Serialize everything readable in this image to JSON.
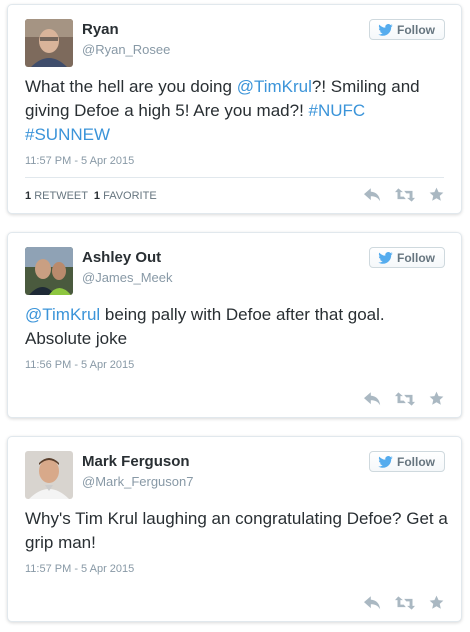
{
  "follow_label": "Follow",
  "colors": {
    "link": "#3b94d9",
    "muted": "#8899a6",
    "bird": "#55acee",
    "action_icon": "#aab8c2"
  },
  "icons": [
    "twitter-bird-icon",
    "reply-icon",
    "retweet-icon",
    "favorite-icon"
  ],
  "tweets": [
    {
      "name": "Ryan",
      "handle": "@Ryan_Rosee",
      "text_parts": [
        "What the hell are you doing ",
        "@TimKrul",
        "?! Smiling and giving Defoe a high 5! Are you mad?! ",
        "#NUFC",
        " ",
        "#SUNNEW"
      ],
      "timestamp": "11:57 PM - 5 Apr 2015",
      "retweets_count": "1",
      "retweets_label": "RETWEET",
      "favorites_count": "1",
      "favorites_label": "FAVORITE"
    },
    {
      "name": "Ashley Out",
      "handle": "@James_Meek",
      "text_parts": [
        "@TimKrul",
        " being pally with Defoe after that goal. Absolute joke"
      ],
      "timestamp": "11:56 PM - 5 Apr 2015"
    },
    {
      "name": "Mark Ferguson",
      "handle": "@Mark_Ferguson7",
      "text_parts": [
        "Why's Tim Krul laughing an congratulating Defoe? Get a grip man!"
      ],
      "timestamp": "11:57 PM - 5 Apr 2015"
    }
  ]
}
